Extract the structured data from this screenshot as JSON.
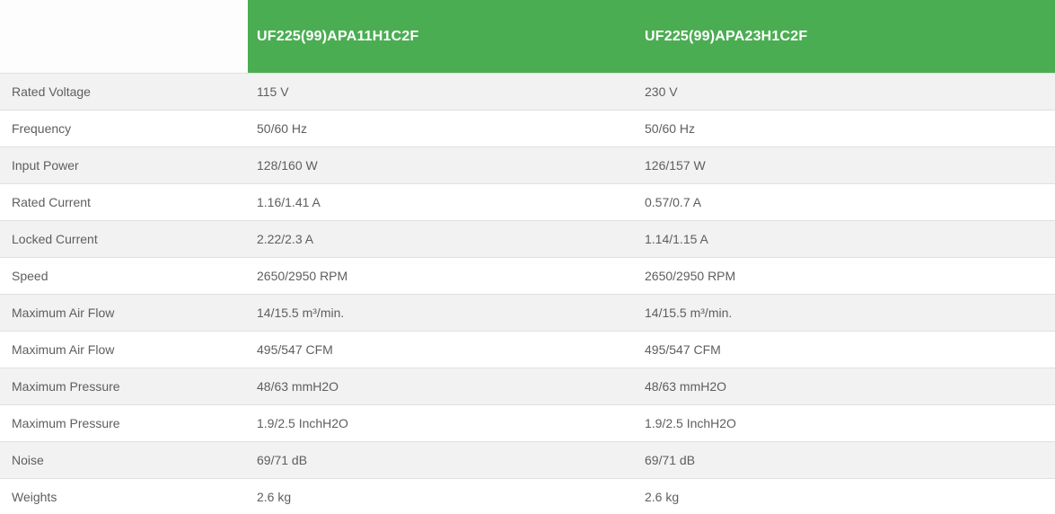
{
  "table": {
    "columns": [
      {
        "label": "UF225(99)APA11H1C2F"
      },
      {
        "label": "UF225(99)APA23H1C2F"
      }
    ],
    "rows": [
      {
        "label": "Rated Voltage",
        "values": [
          "115 V",
          "230 V"
        ]
      },
      {
        "label": "Frequency",
        "values": [
          "50/60 Hz",
          "50/60 Hz"
        ]
      },
      {
        "label": "Input Power",
        "values": [
          "128/160 W",
          "126/157 W"
        ]
      },
      {
        "label": "Rated Current",
        "values": [
          "1.16/1.41 A",
          "0.57/0.7 A"
        ]
      },
      {
        "label": "Locked Current",
        "values": [
          "2.22/2.3 A",
          "1.14/1.15 A"
        ]
      },
      {
        "label": "Speed",
        "values": [
          "2650/2950 RPM",
          "2650/2950 RPM"
        ]
      },
      {
        "label": "Maximum Air Flow",
        "values": [
          "14/15.5 m³/min.",
          "14/15.5 m³/min."
        ]
      },
      {
        "label": "Maximum Air Flow",
        "values": [
          "495/547 CFM",
          "495/547 CFM"
        ]
      },
      {
        "label": "Maximum Pressure",
        "values": [
          "48/63 mmH2O",
          "48/63 mmH2O"
        ]
      },
      {
        "label": "Maximum Pressure",
        "values": [
          "1.9/2.5 InchH2O",
          "1.9/2.5 InchH2O"
        ]
      },
      {
        "label": "Noise",
        "values": [
          "69/71 dB",
          "69/71 dB"
        ]
      },
      {
        "label": "Weights",
        "values": [
          "2.6 kg",
          "2.6 kg"
        ]
      }
    ]
  },
  "colors": {
    "header_green": "#4bad52",
    "row_alt_gray": "#f2f2f2",
    "row_border": "#e0e0e0",
    "body_text": "#5e5e5e",
    "header_text": "#ffffff"
  }
}
